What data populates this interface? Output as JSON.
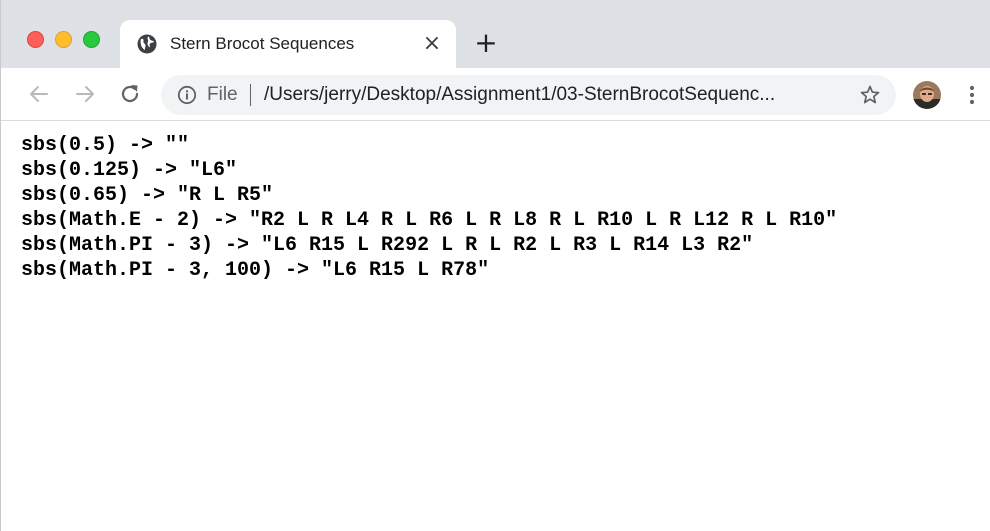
{
  "browser": {
    "tab": {
      "title": "Stern Brocot Sequences",
      "favicon": "globe-icon",
      "close_symbol": "×"
    },
    "new_tab_symbol": "+",
    "address_bar": {
      "scheme_label": "File",
      "url": "/Users/jerry/Desktop/Assignment1/03-SternBrocotSequenc..."
    },
    "icons": {
      "back": "back-arrow-icon",
      "forward": "forward-arrow-icon",
      "reload": "reload-icon",
      "info": "info-icon",
      "bookmark": "star-icon",
      "menu": "kebab-menu-icon"
    },
    "traffic_lights": {
      "close_color": "#fe5f57",
      "minimize_color": "#febc2e",
      "maximize_color": "#28c840"
    }
  },
  "page": {
    "lines": [
      "sbs(0.5) -> \"\"",
      "sbs(0.125) -> \"L6\"",
      "sbs(0.65) -> \"R L R5\"",
      "sbs(Math.E - 2) -> \"R2 L R L4 R L R6 L R L8 R L R10 L R L12 R L R10\"",
      "sbs(Math.PI - 3) -> \"L6 R15 L R292 L R L R2 L R3 L R14 L3 R2\"",
      "sbs(Math.PI - 3, 100) -> \"L6 R15 L R78\""
    ]
  }
}
